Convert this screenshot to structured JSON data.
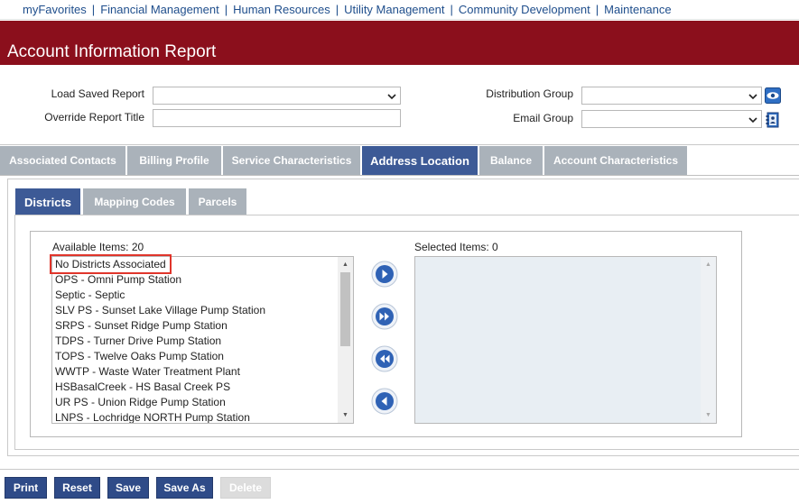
{
  "nav": {
    "items": [
      "myFavorites",
      "Financial Management",
      "Human Resources",
      "Utility Management",
      "Community Development",
      "Maintenance"
    ],
    "separator": "|"
  },
  "page": {
    "title": "Account Information Report"
  },
  "form": {
    "load_saved_report": {
      "label": "Load Saved Report",
      "value": ""
    },
    "override_report_title": {
      "label": "Override Report Title",
      "value": ""
    },
    "distribution_group": {
      "label": "Distribution Group",
      "value": ""
    },
    "email_group": {
      "label": "Email Group",
      "value": ""
    }
  },
  "tabs": [
    {
      "label": "Associated Contacts",
      "active": false
    },
    {
      "label": "Billing Profile",
      "active": false
    },
    {
      "label": "Service Characteristics",
      "active": false
    },
    {
      "label": "Address Location",
      "active": true
    },
    {
      "label": "Balance",
      "active": false
    },
    {
      "label": "Account Characteristics",
      "active": false
    }
  ],
  "subtabs": [
    {
      "label": "Districts",
      "active": true
    },
    {
      "label": "Mapping Codes",
      "active": false
    },
    {
      "label": "Parcels",
      "active": false
    }
  ],
  "available": {
    "label": "Available Items: 20",
    "items": [
      "No Districts Associated",
      "OPS - Omni Pump Station",
      "Septic - Septic",
      "SLV PS - Sunset Lake Village Pump Station",
      "SRPS - Sunset Ridge Pump Station",
      "TDPS - Turner Drive Pump Station",
      "TOPS - Twelve Oaks Pump Station",
      "WWTP - Waste Water Treatment Plant",
      "HSBasalCreek - HS Basal Creek PS",
      "UR PS - Union Ridge Pump Station",
      "LNPS - Lochridge NORTH Pump Station"
    ]
  },
  "selected": {
    "label": "Selected Items: 0",
    "items": []
  },
  "buttons": {
    "print": "Print",
    "reset": "Reset",
    "save": "Save",
    "save_as": "Save As",
    "delete": "Delete"
  },
  "icons": {
    "move_right": "chevron-right-icon",
    "move_all_right": "double-chevron-right-icon",
    "move_all_left": "double-chevron-left-icon",
    "move_left": "chevron-left-icon",
    "view": "eye-icon",
    "address_book": "address-book-icon"
  },
  "colors": {
    "title_bar": "#8b0f1c",
    "tab_active": "#3d5a96",
    "tab_inactive": "#aab2ba",
    "highlight": "#e0352b",
    "button": "#2f4b88"
  }
}
